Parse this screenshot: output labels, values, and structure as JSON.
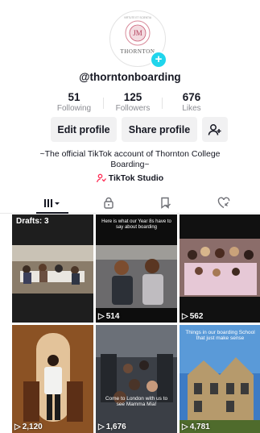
{
  "profile": {
    "avatar_brand_text": "THORNTON",
    "avatar_initials": "JM",
    "avatar_motto": "VIRTUTE ET SCIENTIA",
    "username": "@thorntonboarding",
    "stats": [
      {
        "value": "51",
        "label": "Following"
      },
      {
        "value": "125",
        "label": "Followers"
      },
      {
        "value": "676",
        "label": "Likes"
      }
    ],
    "buttons": {
      "edit": "Edit profile",
      "share": "Share profile"
    },
    "bio_line1": "~The official TikTok account of Thornton College",
    "bio_line2": "Boarding~",
    "studio_label": "TikTok Studio"
  },
  "colors": {
    "accent_cyan": "#20d5ec",
    "studio_pink": "#fe2c55",
    "text": "#161823",
    "muted": "#8a8b91"
  },
  "tabs": [
    "grid-icon",
    "lock-icon",
    "saved-icon",
    "liked-icon"
  ],
  "videos": [
    {
      "label": "Drafts: 3",
      "views": ""
    },
    {
      "caption": "Here is what our Year 8s have to say about boarding",
      "views": "514"
    },
    {
      "caption": "",
      "views": "562"
    },
    {
      "caption": "",
      "views": "2,120"
    },
    {
      "caption": "Come to London with us to see Mamma Mia!",
      "views": "1,676"
    },
    {
      "caption": "Things in our boarding School that just make sense",
      "views": "4,781"
    }
  ]
}
